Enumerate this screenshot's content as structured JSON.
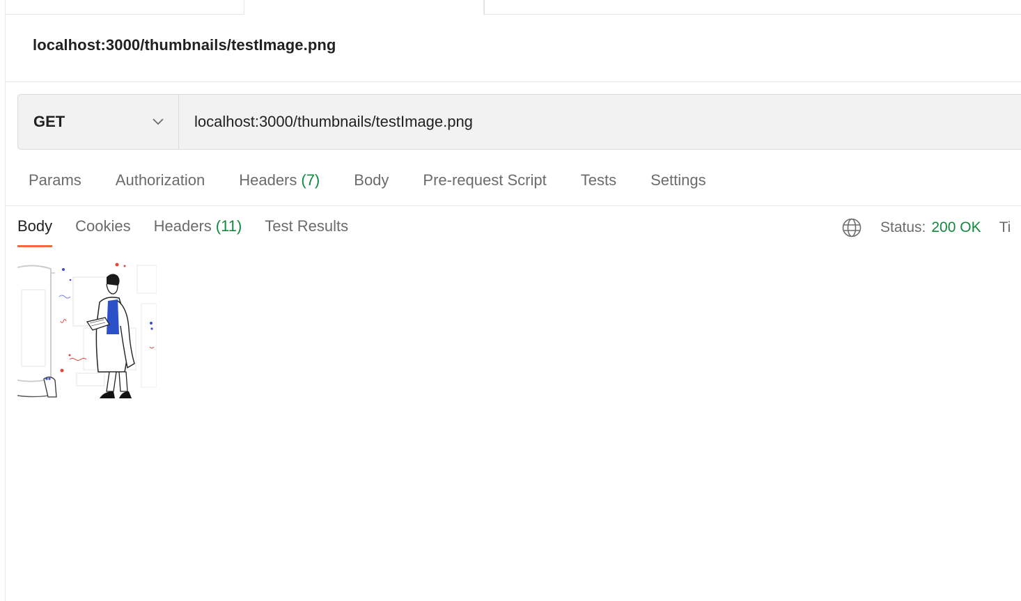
{
  "request": {
    "title": "localhost:3000/thumbnails/testImage.png",
    "method": "GET",
    "url": "localhost:3000/thumbnails/testImage.png"
  },
  "request_tabs": [
    {
      "label": "Params",
      "count": ""
    },
    {
      "label": "Authorization",
      "count": ""
    },
    {
      "label": "Headers",
      "count": "(7)"
    },
    {
      "label": "Body",
      "count": ""
    },
    {
      "label": "Pre-request Script",
      "count": ""
    },
    {
      "label": "Tests",
      "count": ""
    },
    {
      "label": "Settings",
      "count": ""
    }
  ],
  "response_tabs": [
    {
      "label": "Body",
      "count": ""
    },
    {
      "label": "Cookies",
      "count": ""
    },
    {
      "label": "Headers",
      "count": "(11)"
    },
    {
      "label": "Test Results",
      "count": ""
    }
  ],
  "status": {
    "label": "Status:",
    "value": "200 OK",
    "time_label": "Ti"
  },
  "icons": {
    "method_dropdown": "chevron-down-icon",
    "network": "globe-icon"
  },
  "colors": {
    "accent": "#f26b3a",
    "success": "#0f8a3c"
  }
}
